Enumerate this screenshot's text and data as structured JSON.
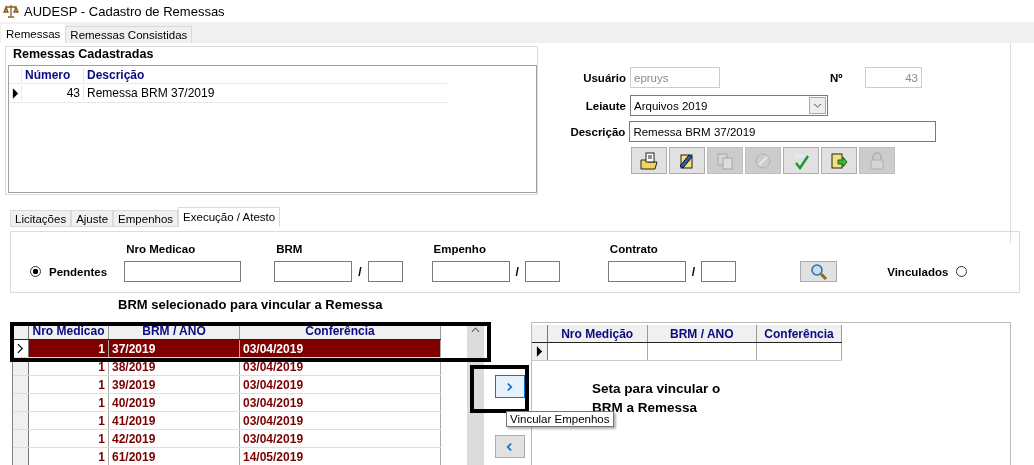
{
  "window": {
    "title": "AUDESP - Cadastro de Remessas"
  },
  "tabs": [
    {
      "label": "Remessas",
      "selected": true
    },
    {
      "label": "Remessas Consistidas",
      "selected": false
    }
  ],
  "remessas_cadastradas": {
    "title": "Remessas Cadastradas",
    "columns": [
      "Número",
      "Descrição"
    ],
    "rows": [
      {
        "numero": "43",
        "descricao": "Remessa BRM 37/2019",
        "selected": true
      }
    ]
  },
  "form": {
    "usuario": {
      "label": "Usuário",
      "value": "epruys",
      "disabled": true
    },
    "numero": {
      "label": "Nº",
      "value": "43",
      "disabled": true
    },
    "leiaute": {
      "label": "Leiaute",
      "value": "Arquivos 2019"
    },
    "descricao": {
      "label": "Descrição",
      "value": "Remessa BRM 37/2019"
    }
  },
  "toolbar": [
    {
      "kind": "open",
      "disabled": false
    },
    {
      "kind": "edit",
      "disabled": false
    },
    {
      "kind": "copy",
      "disabled": true
    },
    {
      "kind": "cancel",
      "disabled": true
    },
    {
      "kind": "spellcheck",
      "disabled": false
    },
    {
      "kind": "export",
      "disabled": false
    },
    {
      "kind": "lock",
      "disabled": true
    }
  ],
  "inner_tabs": [
    {
      "label": "Licitações",
      "selected": false
    },
    {
      "label": "Ajuste",
      "selected": false
    },
    {
      "label": "Empenhos",
      "selected": false
    },
    {
      "label": "Execução / Atesto",
      "selected": true
    }
  ],
  "filter": {
    "pendentes": {
      "label": "Pendentes",
      "selected": true
    },
    "vinculados": {
      "label": "Vinculados",
      "selected": false
    },
    "fields": [
      {
        "label": "Nro Medicao",
        "split": false
      },
      {
        "label": "BRM",
        "split": true,
        "separator": "/"
      },
      {
        "label": "Empenho",
        "split": true,
        "separator": "/"
      },
      {
        "label": "Contrato",
        "split": true,
        "separator": "/"
      }
    ]
  },
  "caption": "BRM selecionado para vincular a Remessa",
  "pending_grid": {
    "columns": [
      "Nro Medicao",
      "BRM / ANO",
      "Conferência"
    ],
    "rows": [
      {
        "nro": "1",
        "brm": "37/2019",
        "conferencia": "03/04/2019",
        "selected": true
      },
      {
        "nro": "1",
        "brm": "38/2019",
        "conferencia": "03/04/2019",
        "selected": false
      },
      {
        "nro": "1",
        "brm": "39/2019",
        "conferencia": "03/04/2019",
        "selected": false
      },
      {
        "nro": "1",
        "brm": "40/2019",
        "conferencia": "03/04/2019",
        "selected": false
      },
      {
        "nro": "1",
        "brm": "41/2019",
        "conferencia": "03/04/2019",
        "selected": false
      },
      {
        "nro": "1",
        "brm": "42/2019",
        "conferencia": "03/04/2019",
        "selected": false
      },
      {
        "nro": "1",
        "brm": "61/2019",
        "conferencia": "14/05/2019",
        "selected": false
      }
    ]
  },
  "linked_grid": {
    "columns": [
      "Nro Medição",
      "BRM / ANO",
      "Conferência"
    ]
  },
  "annotation": "Seta para vincular o BRM a Remessa",
  "tooltip": "Vincular Empenhos"
}
